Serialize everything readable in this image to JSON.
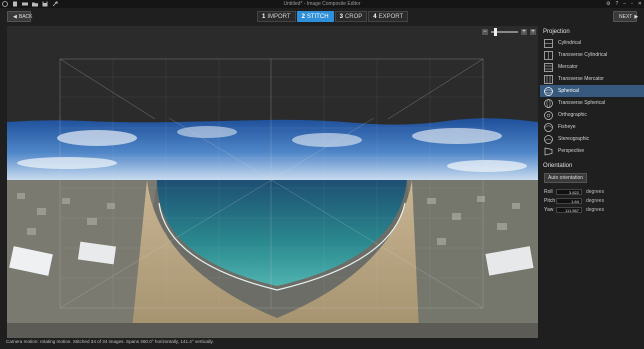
{
  "window": {
    "title": "Untitled* - Image Composite Editor"
  },
  "nav": {
    "back_label": "BACK",
    "next_label": "NEXT",
    "steps": [
      {
        "num": "1",
        "label": "IMPORT"
      },
      {
        "num": "2",
        "label": "STITCH"
      },
      {
        "num": "3",
        "label": "CROP"
      },
      {
        "num": "4",
        "label": "EXPORT"
      }
    ],
    "active_step": "STITCH"
  },
  "zoom": {
    "minus": "−",
    "plus": "+",
    "fit": "+"
  },
  "panel": {
    "projection_title": "Projection",
    "projections": [
      {
        "label": "Cylindrical",
        "icon": "cylindrical-icon"
      },
      {
        "label": "Transverse Cylindrical",
        "icon": "transverse-cylindrical-icon"
      },
      {
        "label": "Mercator",
        "icon": "mercator-icon"
      },
      {
        "label": "Transverse Mercator",
        "icon": "transverse-mercator-icon"
      },
      {
        "label": "Spherical",
        "icon": "spherical-icon"
      },
      {
        "label": "Transverse Spherical",
        "icon": "transverse-spherical-icon"
      },
      {
        "label": "Orthographic",
        "icon": "orthographic-icon"
      },
      {
        "label": "Fisheye",
        "icon": "fisheye-icon"
      },
      {
        "label": "Stereographic",
        "icon": "stereographic-icon"
      },
      {
        "label": "Perspective",
        "icon": "perspective-icon"
      }
    ],
    "selected_projection": "Spherical",
    "orientation_title": "Orientation",
    "auto_orientation_label": "Auto orientation",
    "roll": {
      "label": "Roll",
      "value": "3.822",
      "unit": "degrees"
    },
    "pitch": {
      "label": "Pitch",
      "value": "1.64",
      "unit": "degrees"
    },
    "yaw": {
      "label": "Yaw",
      "value": "111.567",
      "unit": "degrees"
    }
  },
  "status": "Camera motion: rotating motion. Stitched 34 of 34 images. Spans 360.0° horizontally, 141.4° vertically.",
  "colors": {
    "accent": "#2f8fd8",
    "selected_row": "#36597d",
    "background": "#1f1f1f"
  }
}
